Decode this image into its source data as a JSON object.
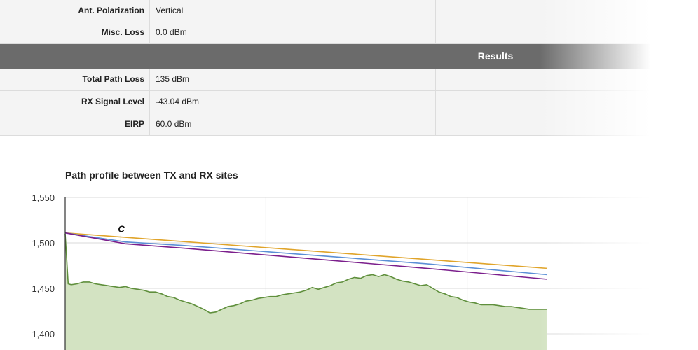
{
  "parameters": [
    {
      "label": "Ant. Polarization",
      "value": "Vertical"
    },
    {
      "label": "Misc. Loss",
      "value": "0.0 dBm"
    }
  ],
  "results_header": "Results",
  "results": [
    {
      "label": "Total Path Loss",
      "value": "135 dBm"
    },
    {
      "label": "RX Signal Level",
      "value": "-43.04 dBm"
    },
    {
      "label": "EIRP",
      "value": "60.0 dBm"
    }
  ],
  "colors": {
    "terrain_line": "#5f8f3c",
    "terrain_fill": "#d3e3c2",
    "line_orange": "#e0a42a",
    "line_blue": "#5b8fd6",
    "line_purple": "#7b1f8c",
    "results_bar": "#6b6b6b"
  },
  "chart_data": {
    "type": "area",
    "title": "Path profile between TX and RX sites",
    "ylim": [
      1400,
      1550
    ],
    "yticks": [
      "1,550",
      "1,500",
      "1,450",
      "1,400"
    ],
    "ytick_values": [
      1550,
      1500,
      1450,
      1400
    ],
    "annotations": [
      {
        "text": "C",
        "x": 0.09,
        "y": 1505
      }
    ],
    "grid": true,
    "series": [
      {
        "kind": "terrain",
        "x": [
          0,
          0.005,
          0.01,
          0.02,
          0.03,
          0.04,
          0.05,
          0.06,
          0.07,
          0.08,
          0.09,
          0.1,
          0.11,
          0.12,
          0.13,
          0.14,
          0.15,
          0.16,
          0.17,
          0.18,
          0.19,
          0.2,
          0.21,
          0.22,
          0.23,
          0.24,
          0.25,
          0.26,
          0.27,
          0.28,
          0.29,
          0.3,
          0.31,
          0.32,
          0.33,
          0.34,
          0.35,
          0.36,
          0.37,
          0.38,
          0.39,
          0.4,
          0.41,
          0.42,
          0.43,
          0.44,
          0.45,
          0.46,
          0.47,
          0.48,
          0.49,
          0.5,
          0.51,
          0.52,
          0.53,
          0.54,
          0.55,
          0.56,
          0.57,
          0.58,
          0.59,
          0.6,
          0.61,
          0.62,
          0.63,
          0.64,
          0.65,
          0.66,
          0.67,
          0.68,
          0.69,
          0.7,
          0.71,
          0.72,
          0.73,
          0.74,
          0.75,
          0.76,
          0.77,
          0.78,
          0.79,
          0.8
        ],
        "values": [
          1510,
          1455,
          1454,
          1455,
          1457,
          1457,
          1455,
          1454,
          1453,
          1452,
          1451,
          1452,
          1450,
          1449,
          1448,
          1446,
          1446,
          1444,
          1441,
          1440,
          1437,
          1435,
          1433,
          1430,
          1427,
          1423,
          1424,
          1427,
          1430,
          1431,
          1433,
          1436,
          1437,
          1439,
          1440,
          1441,
          1441,
          1443,
          1444,
          1445,
          1446,
          1448,
          1451,
          1449,
          1451,
          1453,
          1456,
          1457,
          1460,
          1462,
          1461,
          1464,
          1465,
          1463,
          1465,
          1463,
          1460,
          1458,
          1457,
          1455,
          1453,
          1454,
          1450,
          1446,
          1444,
          1441,
          1440,
          1437,
          1435,
          1434,
          1432,
          1432,
          1432,
          1431,
          1430,
          1430,
          1429,
          1428,
          1427,
          1427,
          1427,
          1427
        ]
      },
      {
        "kind": "line",
        "color_key": "line_orange",
        "x": [
          0,
          0.8
        ],
        "values": [
          1511,
          1472
        ]
      },
      {
        "kind": "line",
        "color_key": "line_blue",
        "x": [
          0,
          0.1,
          0.2,
          0.4,
          0.6,
          0.8
        ],
        "values": [
          1511,
          1501,
          1497,
          1487,
          1477,
          1465
        ]
      },
      {
        "kind": "line",
        "color_key": "line_purple",
        "x": [
          0,
          0.1,
          0.2,
          0.4,
          0.6,
          0.8
        ],
        "values": [
          1511,
          1499,
          1494,
          1483,
          1472,
          1460
        ]
      }
    ]
  }
}
